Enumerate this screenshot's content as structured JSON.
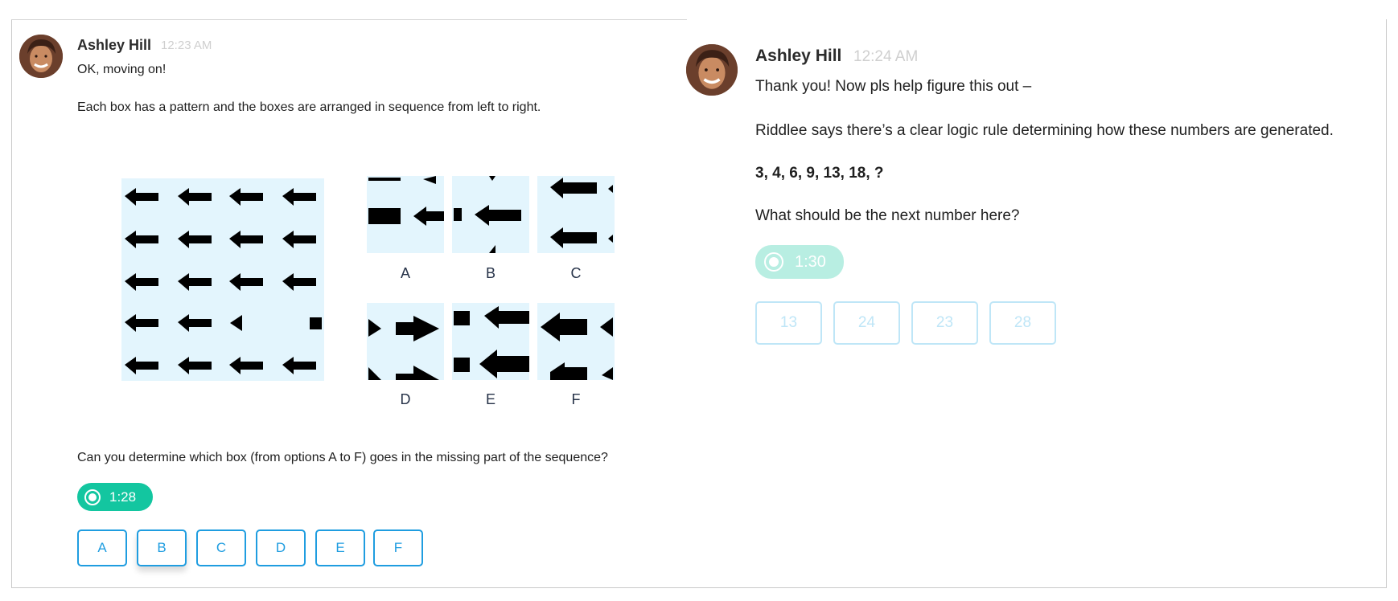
{
  "left": {
    "author": "Ashley Hill",
    "time": "12:23 AM",
    "messages": [
      "OK, moving on!",
      "Each box has a pattern and the boxes are arranged in sequence from left to right.",
      "Can you determine which box (from options A to F) goes in the missing part of the sequence?"
    ],
    "option_labels": [
      "A",
      "B",
      "C",
      "D",
      "E",
      "F"
    ],
    "timer": "1:28",
    "answers": [
      "A",
      "B",
      "C",
      "D",
      "E",
      "F"
    ],
    "colors": {
      "accent": "#13c6a0",
      "button": "#1f9de0",
      "tile": "#e3f5fd"
    }
  },
  "right": {
    "author": "Ashley Hill",
    "time": "12:24 AM",
    "messages": [
      "Thank you! Now pls help figure this out –",
      "Riddlee says there’s a clear logic rule determining how these numbers are generated.",
      "3, 4, 6, 9, 13, 18, ?",
      "What should be the next number here?"
    ],
    "timer": "1:30",
    "answers": [
      "13",
      "24",
      "23",
      "28"
    ],
    "colors": {
      "accent": "#b8eee2",
      "button": "#bfe6f7"
    }
  },
  "icons": [
    "avatar-photo",
    "timer-icon",
    "arrow-left-shape",
    "arrow-right-shape",
    "square-shape",
    "triangle-shape"
  ]
}
